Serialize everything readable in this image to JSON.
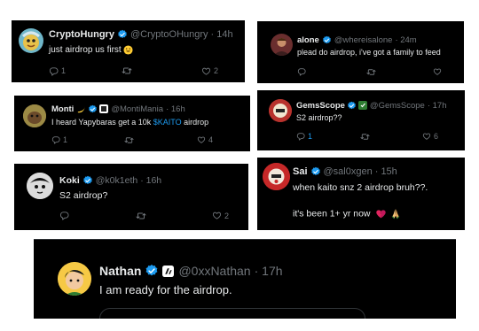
{
  "tweets": [
    {
      "name": "CryptoHungry",
      "handle": "@CryptoOHungry",
      "time": "· 14h",
      "text": "just airdrop us first",
      "replies": "1",
      "retweets": "",
      "likes": "2"
    },
    {
      "name": "alone",
      "handle": "@whereisalone",
      "time": "· 24m",
      "text": "plead do airdrop, i've got a family to feed",
      "replies": "",
      "retweets": "",
      "likes": ""
    },
    {
      "name": "Monti",
      "handle": "@MontiMania",
      "time": "· 16h",
      "text_pre": "I heard Yapybaras get a 10k ",
      "text_tag": "$KAITO",
      "text_post": " airdrop",
      "replies": "1",
      "retweets": "",
      "likes": "4"
    },
    {
      "name": "GemsScope",
      "handle": "@GemsScope",
      "time": "· 17h",
      "text": "S2 airdrop??",
      "replies": "1",
      "retweets": "",
      "likes": "6"
    },
    {
      "name": "Koki",
      "handle": "@k0k1eth",
      "time": "· 16h",
      "text": "S2 airdrop?",
      "replies": "",
      "retweets": "",
      "likes": "2"
    },
    {
      "name": "Sai",
      "handle": "@sal0xgen",
      "time": "· 15h",
      "text": "when kaito snz 2 airdrop bruh??.",
      "text2": "it's been 1+ yr now",
      "replies": "",
      "retweets": "",
      "likes": ""
    },
    {
      "name": "Nathan",
      "handle": "@0xxNathan",
      "time": "· 17h",
      "text": "I am ready for the airdrop."
    }
  ],
  "icons": {
    "reply": "reply-icon",
    "retweet": "retweet-icon",
    "like": "heart-icon",
    "verified": "verified-badge-icon"
  },
  "colors": {
    "background": "#000000",
    "text": "#e7e9ea",
    "muted": "#71767b",
    "verified": "#1d9bf0",
    "cashtag": "#1d9bf0"
  }
}
